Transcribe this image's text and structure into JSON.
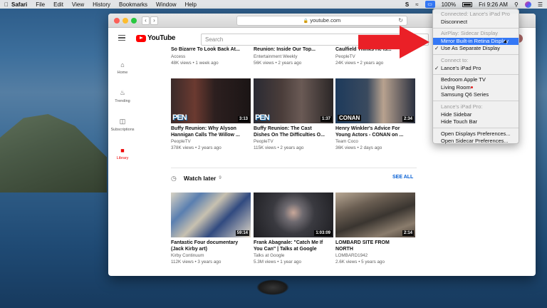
{
  "menubar": {
    "app": "Safari",
    "items": [
      "File",
      "Edit",
      "View",
      "History",
      "Bookmarks",
      "Window",
      "Help"
    ],
    "battery": "100%",
    "clock": "Fri 9:26 AM"
  },
  "browser": {
    "url": "youtube.com"
  },
  "youtube": {
    "logo": "YouTube",
    "search_placeholder": "Search",
    "sidebar": [
      {
        "label": "Home",
        "icon": "home-icon"
      },
      {
        "label": "Trending",
        "icon": "flame-icon"
      },
      {
        "label": "Subscriptions",
        "icon": "subscriptions-icon"
      },
      {
        "label": "Library",
        "icon": "library-icon"
      }
    ],
    "cut_row": [
      {
        "title": "So Bizarre To Look Back At...",
        "channel": "Access",
        "meta": "48K views • 1 week ago"
      },
      {
        "title": "Reunion: Inside Our Top...",
        "channel": "Entertainment Weekly",
        "meta": "56K views • 2 years ago"
      },
      {
        "title": "Caulfield Thinks He Is...",
        "channel": "PeopleTV",
        "meta": "24K views • 2 years ago"
      }
    ],
    "row1": [
      {
        "title1": "Buffy Reunion: Why Alyson",
        "title2": "Hannigan Calls The Willow ...",
        "channel": "PeopleTV",
        "meta": "378K views • 2 years ago",
        "duration": "3:13",
        "badge": "PEN"
      },
      {
        "title1": "Buffy Reunion: The Cast",
        "title2": "Dishes On The Difficulties O...",
        "channel": "PeopleTV",
        "meta": "115K views • 2 years ago",
        "duration": "1:37",
        "badge": "PEN"
      },
      {
        "title1": "Henry Winkler's Advice For",
        "title2": "Young Actors - CONAN on ...",
        "channel": "Team Coco",
        "meta": "36K views • 2 days ago",
        "duration": "2:34",
        "badge": "CONAN"
      }
    ],
    "watch_later": {
      "title": "Watch later",
      "count": "9",
      "see_all": "SEE ALL"
    },
    "row2": [
      {
        "title1": "Fantastic Four documentary",
        "title2": "(Jack Kirby art)",
        "channel": "Kirby Continuum",
        "meta": "112K views • 3 years ago",
        "duration": "59:14"
      },
      {
        "title1": "Frank Abagnale: \"Catch Me If",
        "title2": "You Can\" | Talks at Google",
        "channel": "Talks at Google",
        "meta": "5.3M views • 1 year ago",
        "duration": "1:03:09"
      },
      {
        "title1": "LOMBARD SITE FROM",
        "title2": "NORTH",
        "channel": "LOMBARD1942",
        "meta": "2.6K views • 5 years ago",
        "duration": "2:14"
      }
    ]
  },
  "airplay_menu": {
    "connected_header": "Connected: Lance's iPad Pro",
    "disconnect": "Disconnect",
    "airplay_header": "AirPlay: Sidecar Display",
    "mirror": "Mirror Built-in Retina Display",
    "separate": "Use As Separate Display",
    "connect_header": "Connect to:",
    "ipad": "Lance's iPad Pro",
    "device1": "Bedroom Apple TV",
    "device2": "Living Room",
    "device3": "Samsung Q6 Series",
    "ipad_header": "Lance's iPad Pro:",
    "hide_sidebar": "Hide Sidebar",
    "hide_touchbar": "Hide Touch Bar",
    "open_displays": "Open Displays Preferences...",
    "open_sidecar": "Open Sidecar Preferences..."
  }
}
